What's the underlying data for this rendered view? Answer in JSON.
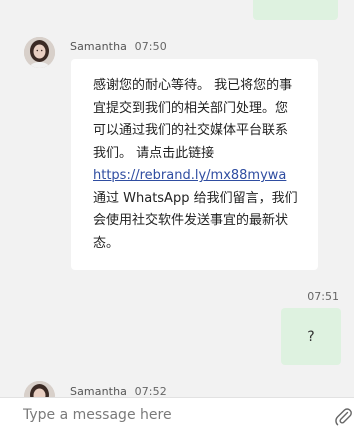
{
  "messages": [
    {
      "sender": "Samantha",
      "time": "07:50",
      "text_before_link": "感谢您的耐心等待。 我已将您的事宜提交到我们的相关部门处理。您可以通过我们的社交媒体平台联系我们。 请点击此链接",
      "link": "https://rebrand.ly/mx88mywa",
      "text_after_link": "通过 WhatsApp 给我们留言，我们会使用社交软件发送事宜的最新状态。"
    },
    {
      "outgoing_time": "07:51",
      "outgoing_text": "?"
    },
    {
      "sender": "Samantha",
      "time": "07:52"
    }
  ],
  "composer": {
    "placeholder": "Type a message here"
  },
  "icons": {
    "attach": "paperclip-icon"
  },
  "colors": {
    "background": "#f2f2f2",
    "incoming_bubble": "#ffffff",
    "outgoing_bubble": "#def2e0",
    "link": "#2f4da1"
  }
}
